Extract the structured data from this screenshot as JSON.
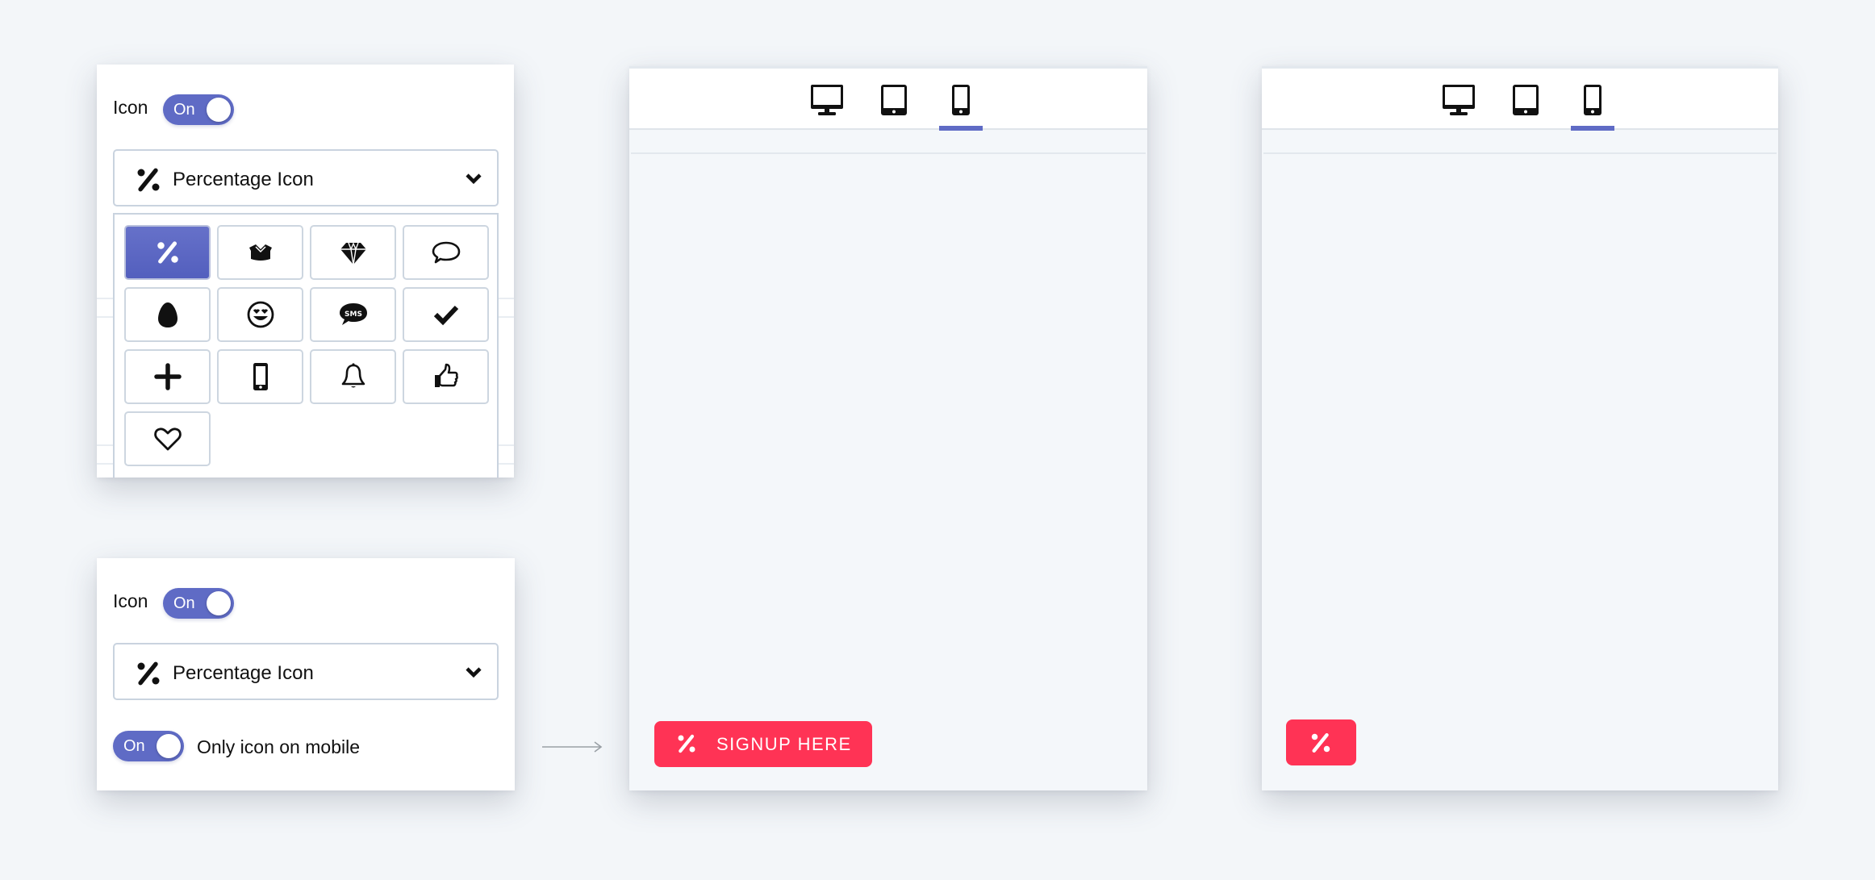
{
  "colors": {
    "accent": "#5f6bc5",
    "cta": "#ff3355",
    "background": "#f3f6f9"
  },
  "settings_expanded": {
    "icon_label": "Icon",
    "icon_toggle": {
      "label": "On",
      "state": true
    },
    "icon_select": {
      "value": "Percentage Icon",
      "icon": "percentage-icon"
    },
    "icon_options": [
      {
        "icon": "percentage-icon",
        "selected": true
      },
      {
        "icon": "open-box-icon",
        "selected": false
      },
      {
        "icon": "diamond-icon",
        "selected": false
      },
      {
        "icon": "speech-bubble-icon",
        "selected": false
      },
      {
        "icon": "egg-icon",
        "selected": false
      },
      {
        "icon": "heart-eyes-smiley-icon",
        "selected": false
      },
      {
        "icon": "sms-bubble-icon",
        "selected": false
      },
      {
        "icon": "checkmark-icon",
        "selected": false
      },
      {
        "icon": "plus-icon",
        "selected": false
      },
      {
        "icon": "mobile-phone-icon",
        "selected": false
      },
      {
        "icon": "bell-icon",
        "selected": false
      },
      {
        "icon": "thumbs-up-icon",
        "selected": false
      },
      {
        "icon": "heart-icon",
        "selected": false
      }
    ]
  },
  "settings_collapsed": {
    "icon_label": "Icon",
    "icon_toggle": {
      "label": "On",
      "state": true
    },
    "icon_select": {
      "value": "Percentage Icon",
      "icon": "percentage-icon"
    },
    "mobile_toggle": {
      "label": "On",
      "state": true
    },
    "mobile_label": "Only icon on mobile"
  },
  "preview_desktop_view": {
    "devices": [
      "desktop-icon",
      "tablet-icon",
      "mobile-icon"
    ],
    "active_device": "mobile",
    "cta_label": "SIGNUP HERE",
    "cta_icon": "percentage-icon"
  },
  "preview_mobile_icon_only": {
    "devices": [
      "desktop-icon",
      "tablet-icon",
      "mobile-icon"
    ],
    "active_device": "mobile",
    "cta_icon": "percentage-icon"
  }
}
